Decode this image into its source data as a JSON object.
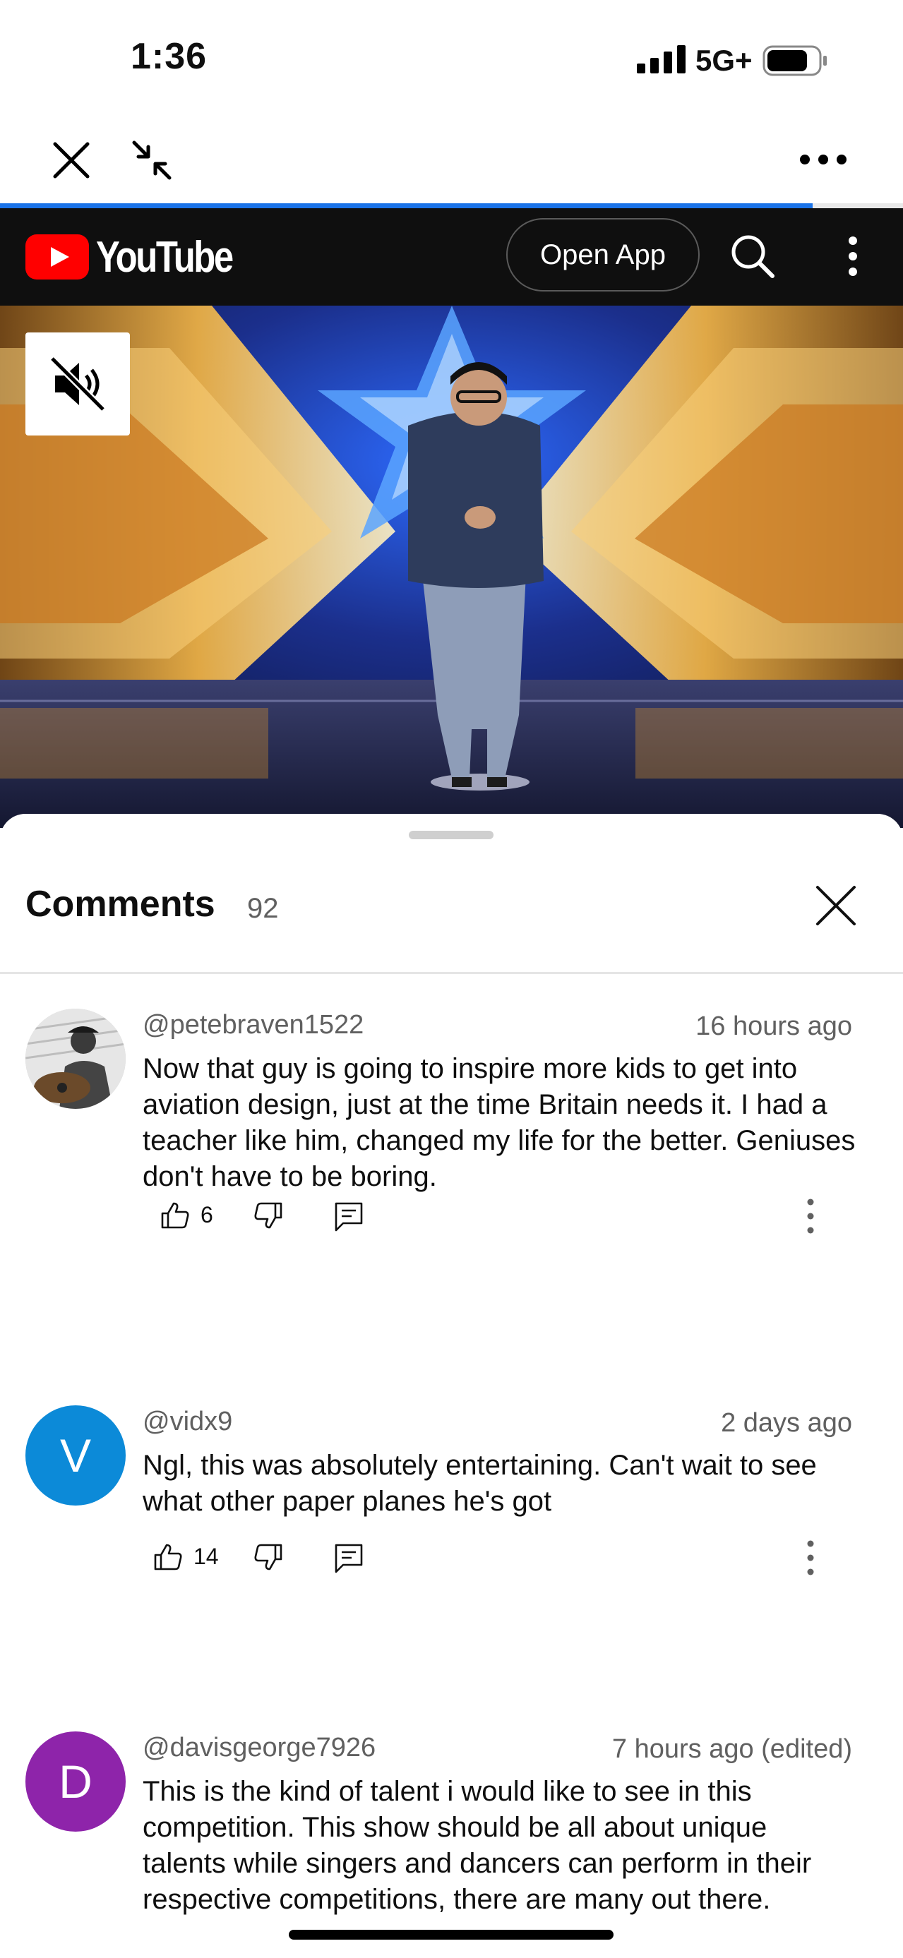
{
  "status_bar": {
    "time": "1:36",
    "network": "5G+",
    "signal_icon": "cellular-signal-icon",
    "battery_icon": "battery-icon"
  },
  "browser_bar": {
    "close_icon": "close-icon",
    "minimize_icon": "minimize-arrows-icon",
    "more_icon": "more-horizontal-icon",
    "load_progress_fraction": 0.9
  },
  "youtube_header": {
    "logo_text": "YouTube",
    "open_app_label": "Open App",
    "search_icon": "search-icon",
    "menu_icon": "more-vertical-icon",
    "brand_color": "#ff0000"
  },
  "video": {
    "mute_icon": "muted-speaker-icon"
  },
  "comments": {
    "title": "Comments",
    "count": "92",
    "close_icon": "close-icon",
    "items": [
      {
        "author": "@petebraven1522",
        "time": "16 hours ago",
        "text": "Now that guy is going to inspire more kids to get into aviation design, just at the time Britain needs it. I had a teacher like him, changed my life for the better. Geniuses don't have to be boring.",
        "likes": "6",
        "avatar_initial": "",
        "avatar_color": "#9a9a9a"
      },
      {
        "author": "@vidx9",
        "time": "2 days ago",
        "text": "Ngl, this was absolutely entertaining. Can't wait to see what other paper planes he's got",
        "likes": "14",
        "avatar_initial": "V",
        "avatar_color": "#0c8ad8"
      },
      {
        "author": "@davisgeorge7926",
        "time": "7 hours ago (edited)",
        "text": "This is the kind of talent i would like to see in this competition. This show should be all about unique talents while singers and dancers can perform in their respective competitions, there are many out there.",
        "likes": "",
        "avatar_initial": "D",
        "avatar_color": "#8e24aa"
      }
    ]
  }
}
